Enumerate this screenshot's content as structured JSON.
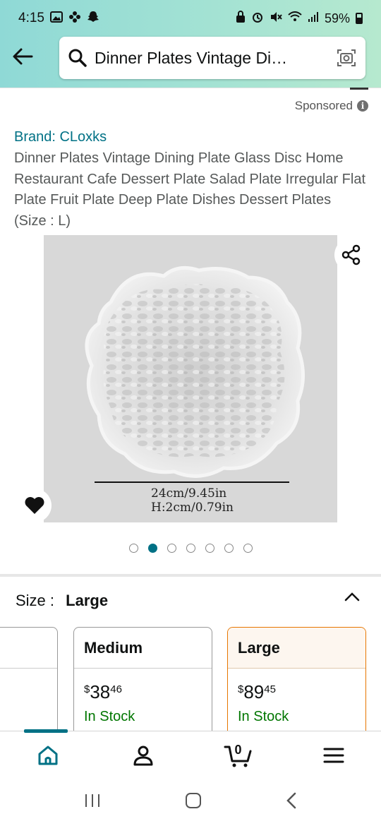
{
  "status_bar": {
    "time": "4:15",
    "battery": "59%"
  },
  "search": {
    "query": "Dinner Plates Vintage Di…"
  },
  "sponsored_label": "Sponsored",
  "product": {
    "brand": "Brand: CLoxks",
    "title": "Dinner Plates Vintage Dining Plate Glass Disc Home Restaurant Cafe Dessert Plate Salad Plate Irregular Flat Plate Fruit Plate Deep Plate Dishes Dessert Plates (Size : L)",
    "image_text_line1": "24cm/9.45in",
    "image_text_line2": "H:2cm/0.79in",
    "image_count": 7,
    "active_image_index": 1
  },
  "size": {
    "label": "Size :",
    "selected": "Large",
    "options": [
      {
        "name": "Medium",
        "price_whole": "38",
        "price_fraction": "46",
        "currency": "$",
        "stock": "In Stock"
      },
      {
        "name": "Large",
        "price_whole": "89",
        "price_fraction": "45",
        "currency": "$",
        "stock": "In Stock"
      }
    ]
  },
  "bottom_nav": {
    "cart_count": "0"
  },
  "colors": {
    "accent": "#007185",
    "stock_green": "#007600",
    "selected_border": "#e77600"
  },
  "icons": [
    "back-arrow-icon",
    "search-icon",
    "camera-icon",
    "info-icon",
    "share-icon",
    "heart-icon",
    "chevron-up-icon",
    "home-icon",
    "account-icon",
    "cart-icon",
    "menu-icon"
  ]
}
